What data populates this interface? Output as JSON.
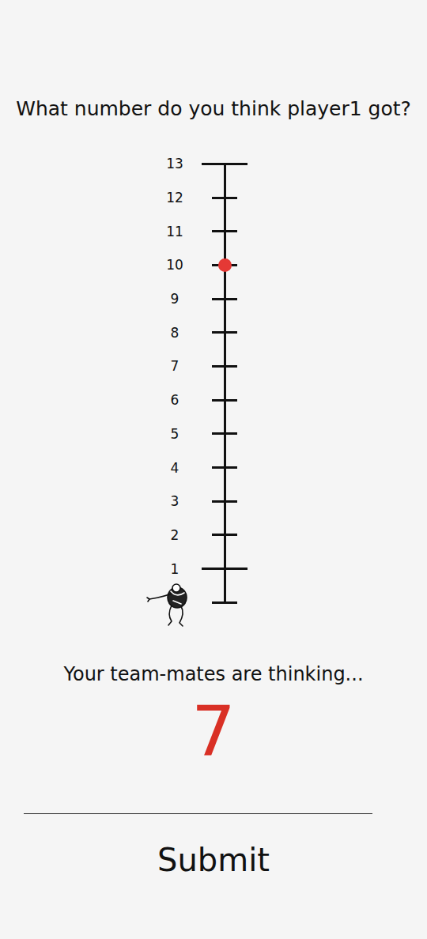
{
  "question": "What number do you think player1 got?",
  "scale": {
    "ticks": [
      {
        "label": "13",
        "kind": "end",
        "selected": false
      },
      {
        "label": "12",
        "kind": "mid",
        "selected": false
      },
      {
        "label": "11",
        "kind": "mid",
        "selected": false
      },
      {
        "label": "10",
        "kind": "mid",
        "selected": true
      },
      {
        "label": "9",
        "kind": "mid",
        "selected": false
      },
      {
        "label": "8",
        "kind": "mid",
        "selected": false
      },
      {
        "label": "7",
        "kind": "mid",
        "selected": false
      },
      {
        "label": "6",
        "kind": "mid",
        "selected": false
      },
      {
        "label": "5",
        "kind": "mid",
        "selected": false
      },
      {
        "label": "4",
        "kind": "mid",
        "selected": false
      },
      {
        "label": "3",
        "kind": "mid",
        "selected": false
      },
      {
        "label": "2",
        "kind": "mid",
        "selected": false
      },
      {
        "label": "1",
        "kind": "end",
        "selected": false
      }
    ]
  },
  "team": {
    "label": "Your team-mates are thinking...",
    "value": "7"
  },
  "submit": "Submit"
}
